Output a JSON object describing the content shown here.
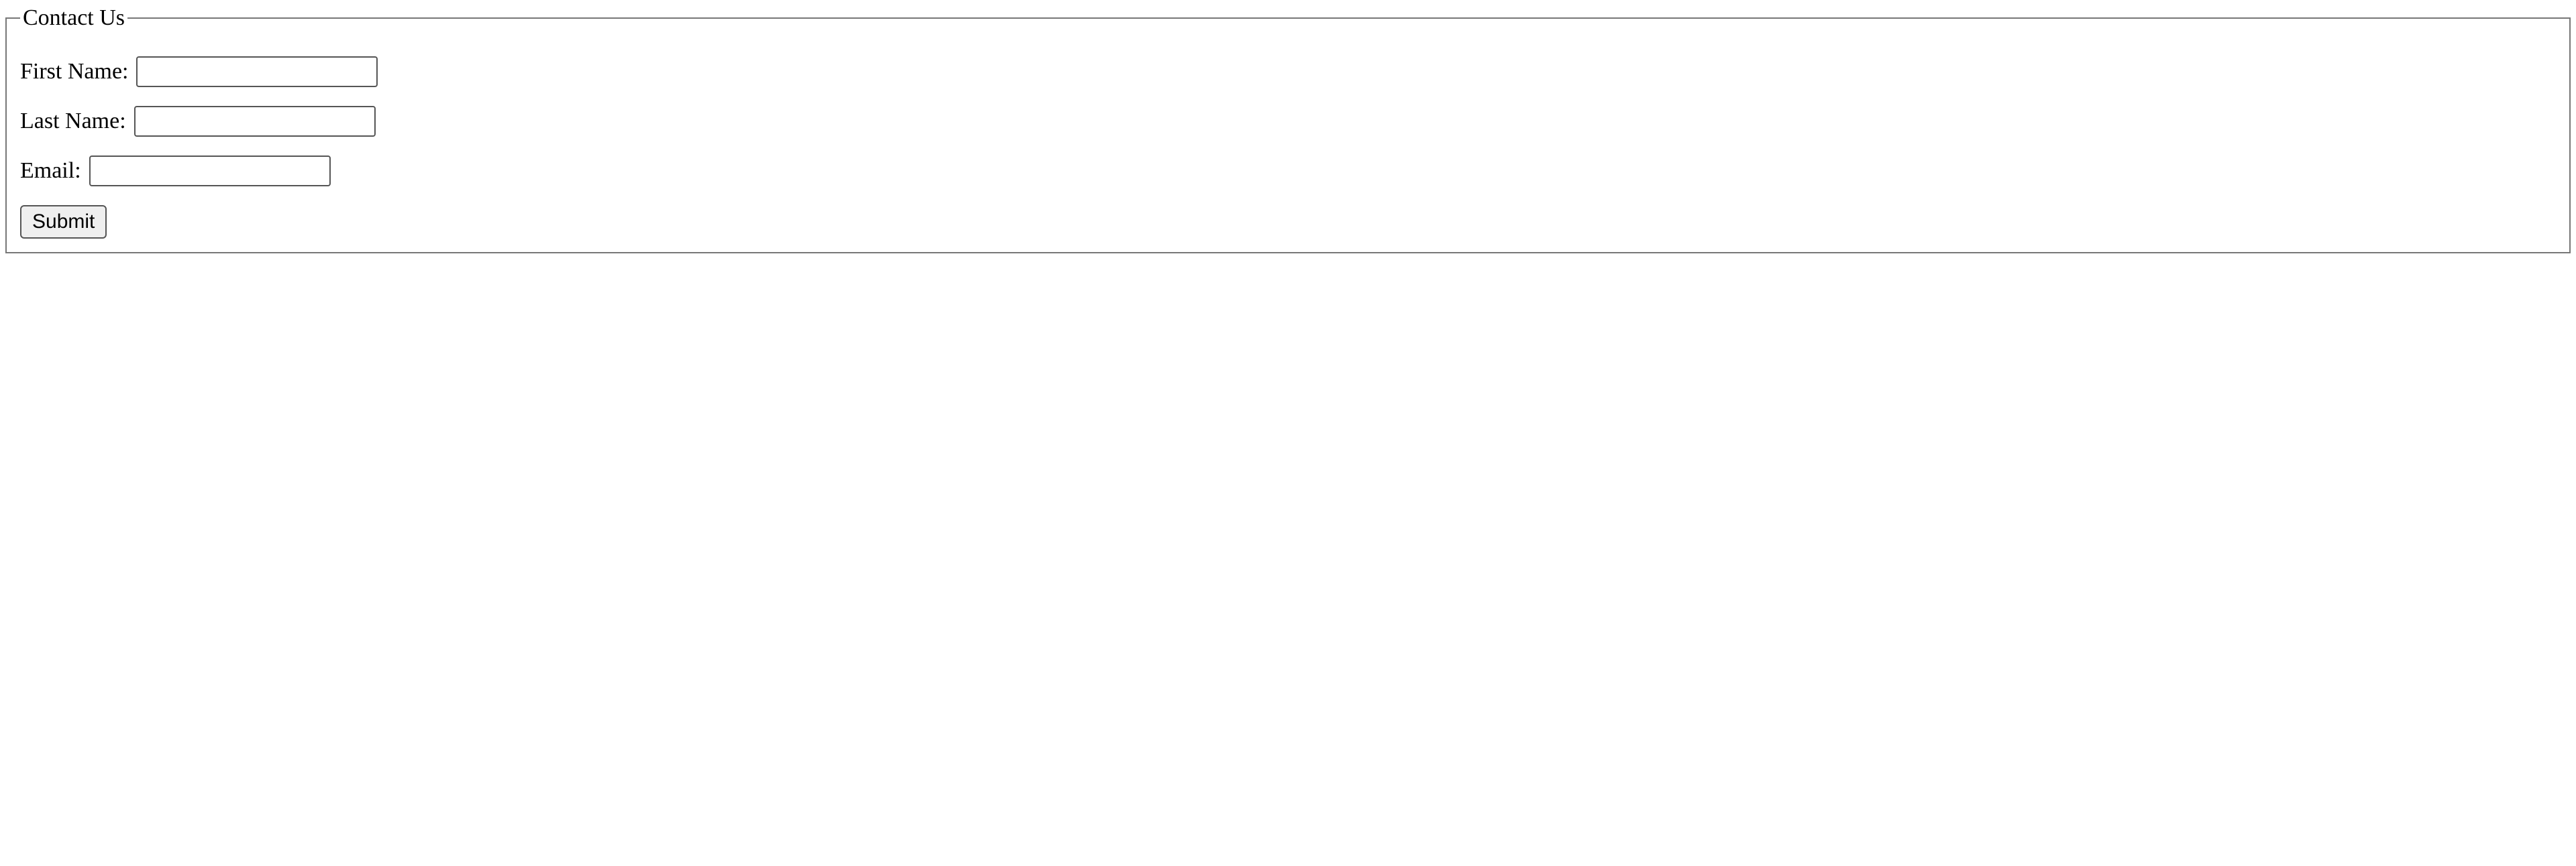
{
  "form": {
    "legend": "Contact Us",
    "fields": {
      "first_name_label": "First Name:",
      "first_name_value": "",
      "last_name_label": "Last Name:",
      "last_name_value": "",
      "email_label": "Email:",
      "email_value": ""
    },
    "submit_label": "Submit"
  }
}
